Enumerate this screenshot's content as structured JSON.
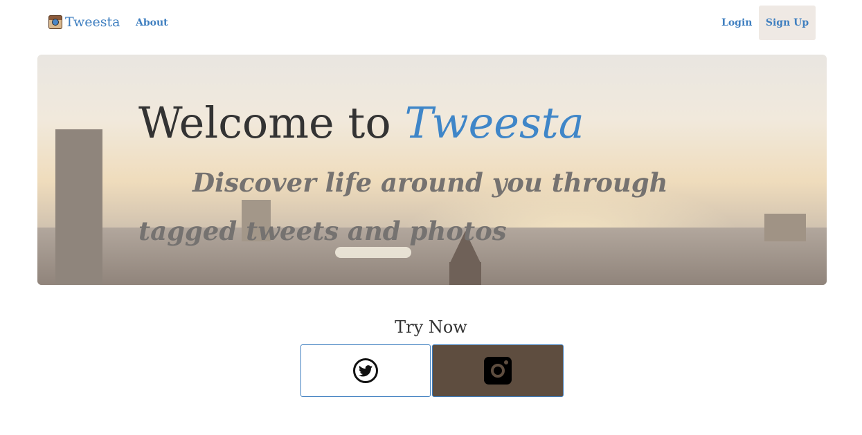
{
  "nav": {
    "brand": "Tweesta",
    "brand_icon": "camera-logo-icon",
    "about": "About",
    "login": "Login",
    "signup": "Sign Up"
  },
  "hero": {
    "title_prefix": "Welcome to ",
    "title_accent": "Tweesta",
    "subtitle": "Discover life around you through tagged tweets and photos"
  },
  "try": {
    "title": "Try Now",
    "twitter_icon": "twitter-icon",
    "instagram_icon": "instagram-icon"
  },
  "colors": {
    "accent": "#3f7fc0",
    "instagram_bg": "#5e4d3f",
    "signup_bg": "#efe9e4"
  }
}
